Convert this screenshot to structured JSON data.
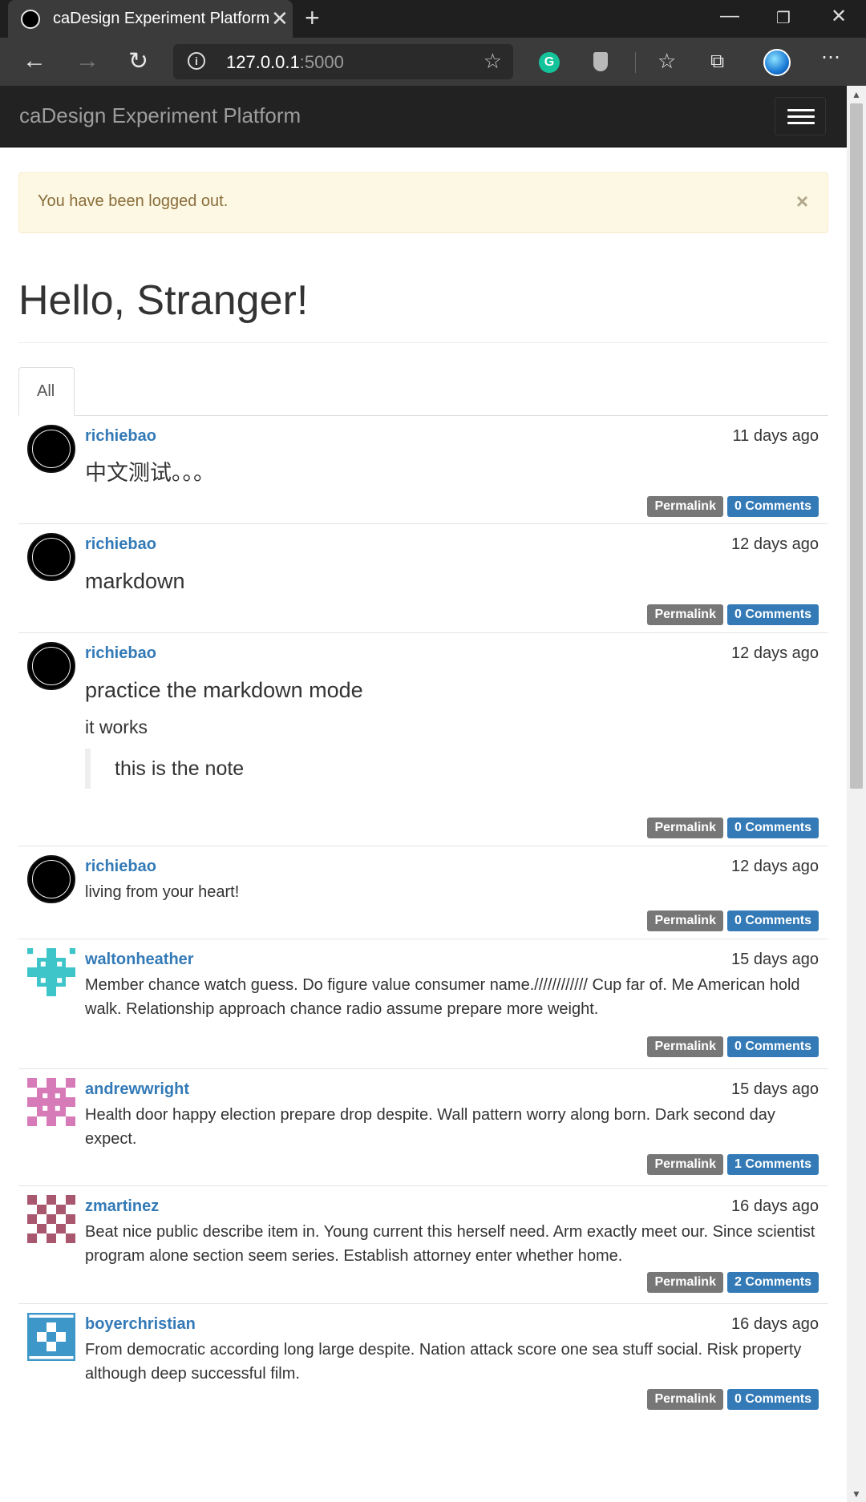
{
  "browser": {
    "tab_title": "caDesign Experiment Platform",
    "address_host": "127.0.0.1",
    "address_port": ":5000"
  },
  "navbar": {
    "brand": "caDesign Experiment Platform"
  },
  "alert": {
    "message": "You have been logged out.",
    "close": "×"
  },
  "page": {
    "heading": "Hello, Stranger!"
  },
  "tabs": [
    {
      "label": "All"
    }
  ],
  "posts": [
    {
      "author": "richiebao",
      "date": "11 days ago",
      "body": "中文测试。。。",
      "permalink": "Permalink",
      "comments": "0 Comments"
    },
    {
      "author": "richiebao",
      "date": "12 days ago",
      "body": "markdown",
      "permalink": "Permalink",
      "comments": "0 Comments"
    },
    {
      "author": "richiebao",
      "date": "12 days ago",
      "heading": "practice the markdown mode",
      "paragraph": "it works",
      "quote": "this is the note",
      "permalink": "Permalink",
      "comments": "0 Comments"
    },
    {
      "author": "richiebao",
      "date": "12 days ago",
      "body": "living from your heart!",
      "permalink": "Permalink",
      "comments": "0 Comments"
    },
    {
      "author": "waltonheather",
      "date": "15 days ago",
      "body": "Member chance watch guess. Do figure value consumer name.//////////// Cup far of. Me American hold walk. Relationship approach chance radio assume prepare more weight.",
      "permalink": "Permalink",
      "comments": "0 Comments",
      "avatar_color": "#3ec5c9"
    },
    {
      "author": "andrewwright",
      "date": "15 days ago",
      "body": "Health door happy election prepare drop despite. Wall pattern worry along born. Dark second day expect.",
      "permalink": "Permalink",
      "comments": "1 Comments",
      "avatar_color": "#d67ab8"
    },
    {
      "author": "zmartinez",
      "date": "16 days ago",
      "body": "Beat nice public describe item in. Young current this herself need. Arm exactly meet our. Since scientist program alone section seem series. Establish attorney enter whether home.",
      "permalink": "Permalink",
      "comments": "2 Comments",
      "avatar_color": "#a8576e"
    },
    {
      "author": "boyerchristian",
      "date": "16 days ago",
      "body": "From democratic according long large despite. Nation attack score one sea stuff social. Risk property although deep successful film.",
      "permalink": "Permalink",
      "comments": "0 Comments",
      "avatar_color": "#3d97c9"
    }
  ]
}
